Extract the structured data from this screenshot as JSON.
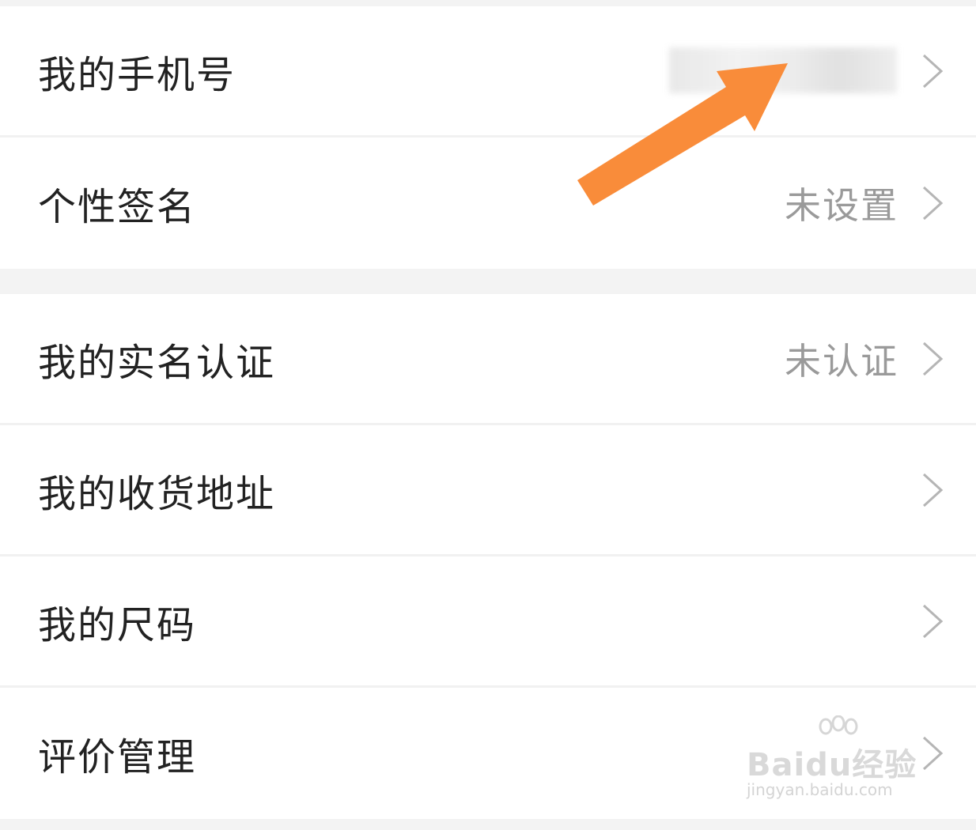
{
  "rows_group1": [
    {
      "label": "我的手机号",
      "value": ""
    },
    {
      "label": "个性签名",
      "value": "未设置"
    }
  ],
  "rows_group2": [
    {
      "label": "我的实名认证",
      "value": "未认证"
    },
    {
      "label": "我的收货地址",
      "value": ""
    },
    {
      "label": "我的尺码",
      "value": ""
    },
    {
      "label": "评价管理",
      "value": ""
    }
  ],
  "watermark": {
    "main": "Baidu经验",
    "sub": "jingyan.baidu.com"
  },
  "colors": {
    "arrow": "#f98c3a",
    "label": "#222222",
    "value": "#9a9a9a"
  },
  "icons": {
    "chevron": "chevron-right-icon",
    "annotation": "orange-arrow-icon"
  }
}
